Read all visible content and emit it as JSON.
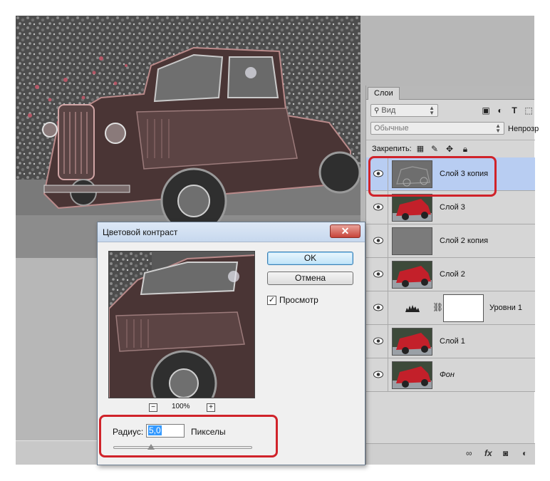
{
  "dialog": {
    "title": "Цветовой контраст",
    "close_glyph": "✕",
    "ok_label": "OK",
    "cancel_label": "Отмена",
    "preview_checkbox_label": "Просмотр",
    "preview_checked": true,
    "zoom_minus": "−",
    "zoom_plus": "+",
    "zoom_value": "100%",
    "radius_label": "Радиус:",
    "radius_value": "5,0",
    "radius_unit": "Пикселы",
    "radius_slider_fraction": 0.27
  },
  "layers_panel": {
    "tab_label": "Слои",
    "filter_placeholder": "Вид",
    "blend_mode": "Обычные",
    "opacity_label": "Непрозр",
    "lock_label": "Закрепить:",
    "toolbar_icons": [
      "image-filter-icon",
      "adjustment-filter-icon",
      "type-filter-icon",
      "shape-filter-icon"
    ],
    "lock_icons": [
      "lock-transparent-icon",
      "lock-image-icon",
      "lock-position-icon",
      "lock-all-icon"
    ],
    "layers": [
      {
        "name": "Слой 3 копия",
        "thumb": "grey-relief",
        "selected": true,
        "italic": false
      },
      {
        "name": "Слой 3",
        "thumb": "red-truck",
        "selected": false,
        "italic": false
      },
      {
        "name": "Слой 2 копия",
        "thumb": "grey-flat",
        "selected": false,
        "italic": false
      },
      {
        "name": "Слой 2",
        "thumb": "red-truck",
        "selected": false,
        "italic": false
      },
      {
        "name": "Уровни 1",
        "thumb": "levels-adjustment",
        "selected": false,
        "italic": false
      },
      {
        "name": "Слой 1",
        "thumb": "red-truck",
        "selected": false,
        "italic": false
      },
      {
        "name": "Фон",
        "thumb": "red-truck",
        "selected": false,
        "italic": true
      }
    ],
    "footer_icons": [
      "link-layers-icon",
      "fx-icon",
      "add-mask-icon",
      "adjustment-layer-icon"
    ]
  },
  "colors": {
    "highlight": "#d0232a",
    "selected_layer": "#b8cdf2",
    "panel_bg": "#d6d6d6"
  }
}
